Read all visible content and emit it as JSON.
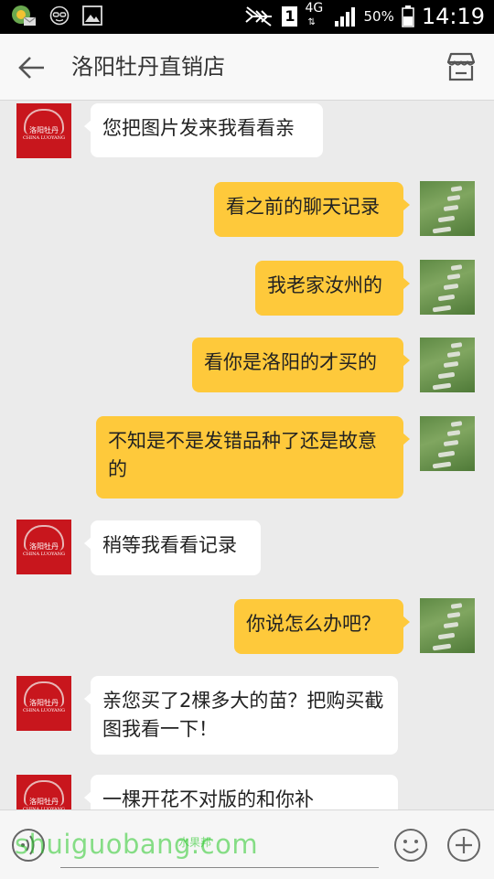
{
  "status_bar": {
    "network": "4G",
    "sim": "1",
    "battery": "50%",
    "time": "14:19"
  },
  "header": {
    "title": "洛阳牡丹直销店",
    "back_icon": "arrow-left-icon",
    "store_icon": "store-icon"
  },
  "shop_avatar_text": [
    "洛阳牡丹",
    "CHINA LUOYANG"
  ],
  "messages": [
    {
      "side": "left",
      "text": "您把图片发来我看看亲"
    },
    {
      "side": "right",
      "text": "看之前的聊天记录"
    },
    {
      "side": "right",
      "text": "我老家汝州的"
    },
    {
      "side": "right",
      "text": "看你是洛阳的才买的"
    },
    {
      "side": "right",
      "text": "不知是不是发错品种了还是故意的"
    },
    {
      "side": "left",
      "text": "稍等我看看记录"
    },
    {
      "side": "right",
      "text": "你说怎么办吧？"
    },
    {
      "side": "left",
      "text": "亲您买了2棵多大的苗？把购买截图我看一下！"
    },
    {
      "side": "left",
      "text": "一棵开花不对版的和你补"
    }
  ],
  "input_bar": {
    "voice_icon": "voice-icon",
    "emoji_icon": "emoji-icon",
    "plus_icon": "plus-icon",
    "text_value": ""
  },
  "watermark": {
    "text": "shuiguobang.com",
    "cn": "水果邦"
  },
  "colors": {
    "outgoing_bubble": "#fec93b",
    "incoming_bubble": "#ffffff",
    "background": "#ebebeb",
    "shop_avatar": "#c8161d"
  }
}
